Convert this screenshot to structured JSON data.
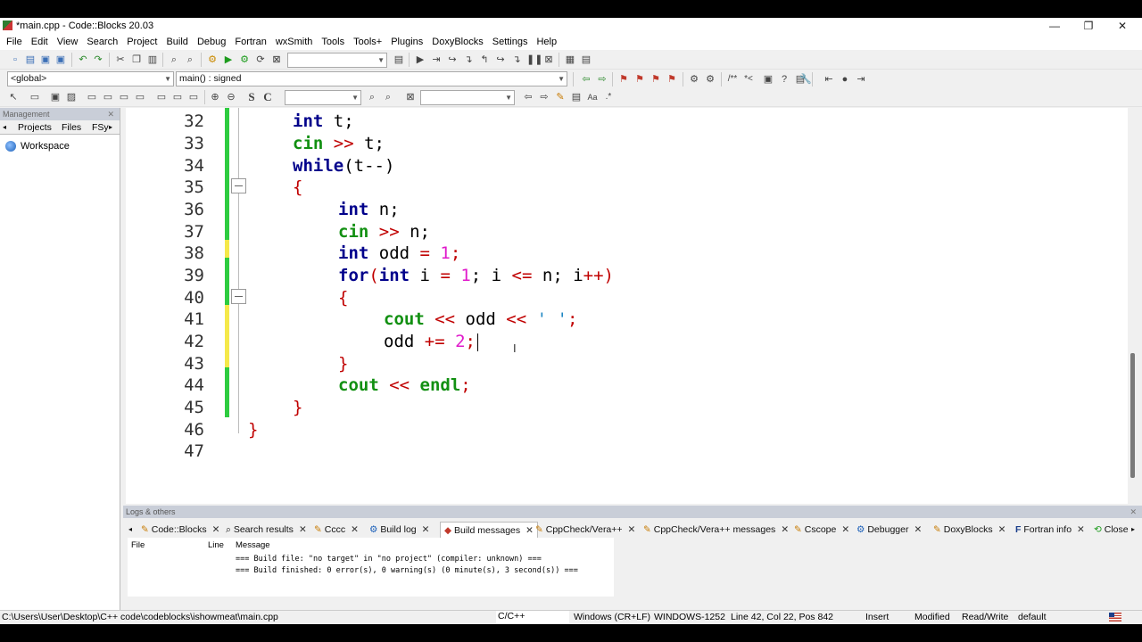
{
  "window": {
    "title": "*main.cpp - Code::Blocks 20.03",
    "minimize": "—",
    "restore": "❐",
    "close": "✕"
  },
  "menu": [
    "File",
    "Edit",
    "View",
    "Search",
    "Project",
    "Build",
    "Debug",
    "Fortran",
    "wxSmith",
    "Tools",
    "Tools+",
    "Plugins",
    "DoxyBlocks",
    "Settings",
    "Help"
  ],
  "toolbar": {
    "scope": "<global>",
    "function": "main() : signed"
  },
  "management": {
    "header": "Management",
    "tabs": [
      "Projects",
      "Files",
      "FSy"
    ],
    "workspace": "Workspace"
  },
  "editor": {
    "lines": [
      "32",
      "33",
      "34",
      "35",
      "36",
      "37",
      "38",
      "39",
      "40",
      "41",
      "42",
      "43",
      "44",
      "45",
      "46",
      "47"
    ],
    "colors": {
      "changed_saved": "#2ecc40",
      "changed_unsaved": "#f5e94a",
      "keyword": "#00008b",
      "std": "#129012",
      "operator": "#c00000",
      "number": "#e01acb"
    }
  },
  "code": {
    "l32": {
      "kw": "int",
      "rest": " t;"
    },
    "l33": {
      "std": "cin",
      "op": " >>",
      "rest": " t;"
    },
    "l34": {
      "kw": "while",
      "rest": "(t--)"
    },
    "l35": {
      "brace": "{"
    },
    "l36": {
      "kw": "int",
      "rest": " n;"
    },
    "l37": {
      "std": "cin",
      "op": " >>",
      "rest": " n;"
    },
    "l38": {
      "kw": "int",
      "rest": " odd ",
      "op": "=",
      "num": " 1",
      "end": ";"
    },
    "l39": {
      "kw": "for",
      "p1": "(",
      "kw2": "int",
      "rest": " i ",
      "op": "=",
      "num": " 1",
      "rest2": "; i ",
      "op2": "<=",
      "rest3": " n; i",
      "op3": "++",
      "end": ")"
    },
    "l40": {
      "brace": "{"
    },
    "l41": {
      "std": "cout",
      "op": " <<",
      "rest": " odd ",
      "op2": "<<",
      "str": " ' '",
      "end": ";"
    },
    "l42": {
      "rest": "odd ",
      "op": "+=",
      "num": " 2",
      "end": ";"
    },
    "l43": {
      "brace": "}"
    },
    "l44": {
      "std": "cout",
      "op": " <<",
      "std2": " endl",
      "end": ";"
    },
    "l45": {
      "brace": "}"
    },
    "l46": {
      "brace": "}"
    }
  },
  "logs": {
    "header": "Logs & others",
    "tabs": [
      "Code::Blocks",
      "Search results",
      "Cccc",
      "Build log",
      "Build messages",
      "CppCheck/Vera++",
      "CppCheck/Vera++ messages",
      "Cscope",
      "Debugger",
      "DoxyBlocks",
      "Fortran info",
      "Close"
    ],
    "columns": [
      "File",
      "Line",
      "Message"
    ],
    "messages": [
      "=== Build file: \"no target\" in \"no project\" (compiler: unknown) ===",
      "=== Build finished: 0 error(s), 0 warning(s) (0 minute(s), 3 second(s)) ==="
    ]
  },
  "status": {
    "path": "C:\\Users\\User\\Desktop\\C++ code\\codeblocks\\ishowmeat\\main.cpp",
    "lang": "C/C++",
    "eol": "Windows (CR+LF)",
    "encoding": "WINDOWS-1252",
    "position": "Line 42, Col 22, Pos 842",
    "mode": "Insert",
    "modified": "Modified",
    "access": "Read/Write",
    "profile": "default"
  }
}
